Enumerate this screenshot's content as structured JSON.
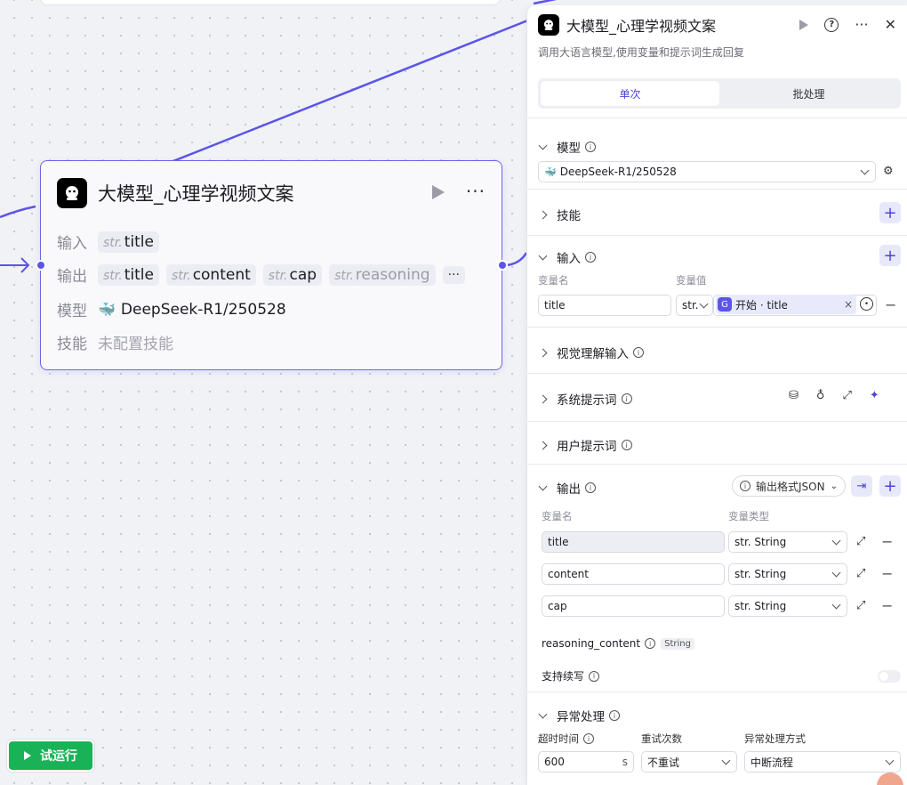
{
  "node": {
    "title": "大模型_心理学视频文案",
    "input_label": "输入",
    "output_label": "输出",
    "model_label": "模型",
    "skill_label": "技能",
    "type_prefix": "str.",
    "inputs": [
      "title"
    ],
    "outputs": [
      "title",
      "content",
      "cap",
      "reasoning"
    ],
    "more": "···",
    "model_name": "DeepSeek-R1/250528",
    "skill_value": "未配置技能"
  },
  "run_button": {
    "label": "试运行"
  },
  "panel": {
    "title": "大模型_心理学视频文案",
    "description": "调用大语言模型,使用变量和提示词生成回复",
    "close": "✕",
    "help": "?",
    "tabs": {
      "single": "单次",
      "batch": "批处理"
    },
    "model_section": {
      "label": "模型",
      "value": "DeepSeek-R1/250528"
    },
    "skill_section": {
      "label": "技能"
    },
    "input_section": {
      "label": "输入",
      "col_name": "变量名",
      "col_value": "变量值",
      "row": {
        "name": "title",
        "type": "str.",
        "ref_source": "开始",
        "ref_var": "title",
        "ref_text": "开始 · title"
      }
    },
    "vision_section": {
      "label": "视觉理解输入"
    },
    "system_prompt_section": {
      "label": "系统提示词"
    },
    "user_prompt_section": {
      "label": "用户提示词"
    },
    "output_section": {
      "label": "输出",
      "format_button": "输出格式JSON",
      "col_name": "变量名",
      "col_type": "变量类型",
      "rows": [
        {
          "name": "title",
          "type": "str. String"
        },
        {
          "name": "content",
          "type": "str. String"
        },
        {
          "name": "cap",
          "type": "str. String"
        }
      ],
      "reasoning_name": "reasoning_content",
      "reasoning_type": "String",
      "continue_label": "支持续写"
    },
    "exception_section": {
      "label": "异常处理",
      "timeout_label": "超时时间",
      "timeout_value": "600",
      "timeout_unit": "s",
      "retry_label": "重试次数",
      "retry_value": "不重试",
      "mode_label": "异常处理方式",
      "mode_value": "中断流程"
    }
  },
  "colors": {
    "accent": "#5b55e8",
    "run_green": "#19b257",
    "node_border": "#6b66ea"
  }
}
